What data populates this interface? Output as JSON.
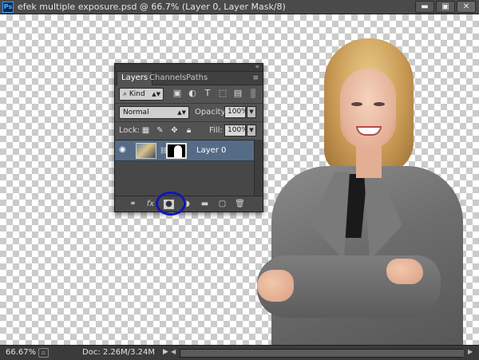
{
  "window": {
    "app_icon_label": "Ps",
    "title": "efek multiple exposure.psd @ 66.7% (Layer 0, Layer Mask/8)",
    "minimize_label": "▬",
    "maximize_label": "▣",
    "close_label": "✕"
  },
  "layers_panel": {
    "collapse_label": "«",
    "tabs": [
      {
        "label": "Layers",
        "active": true
      },
      {
        "label": "Channels",
        "active": false
      },
      {
        "label": "Paths",
        "active": false
      }
    ],
    "menu_label": "≡",
    "filter": {
      "kind_value": "Kind",
      "icons": [
        "image-filter-icon",
        "adjustment-filter-icon",
        "type-filter-icon",
        "shape-filter-icon",
        "smart-object-filter-icon"
      ]
    },
    "blend_mode": "Normal",
    "opacity_label": "Opacity:",
    "opacity_value": "100%",
    "lock_label": "Lock:",
    "fill_label": "Fill:",
    "fill_value": "100%",
    "layers": [
      {
        "name": "Layer 0",
        "visible": true,
        "has_mask": true,
        "selected": true
      }
    ],
    "footer_icons": [
      "link-layers-icon",
      "fx-icon",
      "add-mask-icon",
      "adjustment-layer-icon",
      "new-group-icon",
      "new-layer-icon",
      "trash-icon"
    ],
    "fx_label": "fx"
  },
  "status_bar": {
    "zoom": "66.67%",
    "doc_info": "Doc: 2.26M/3.24M"
  },
  "colors": {
    "highlight_ring": "#1016b8",
    "selected_layer": "#566b86"
  }
}
